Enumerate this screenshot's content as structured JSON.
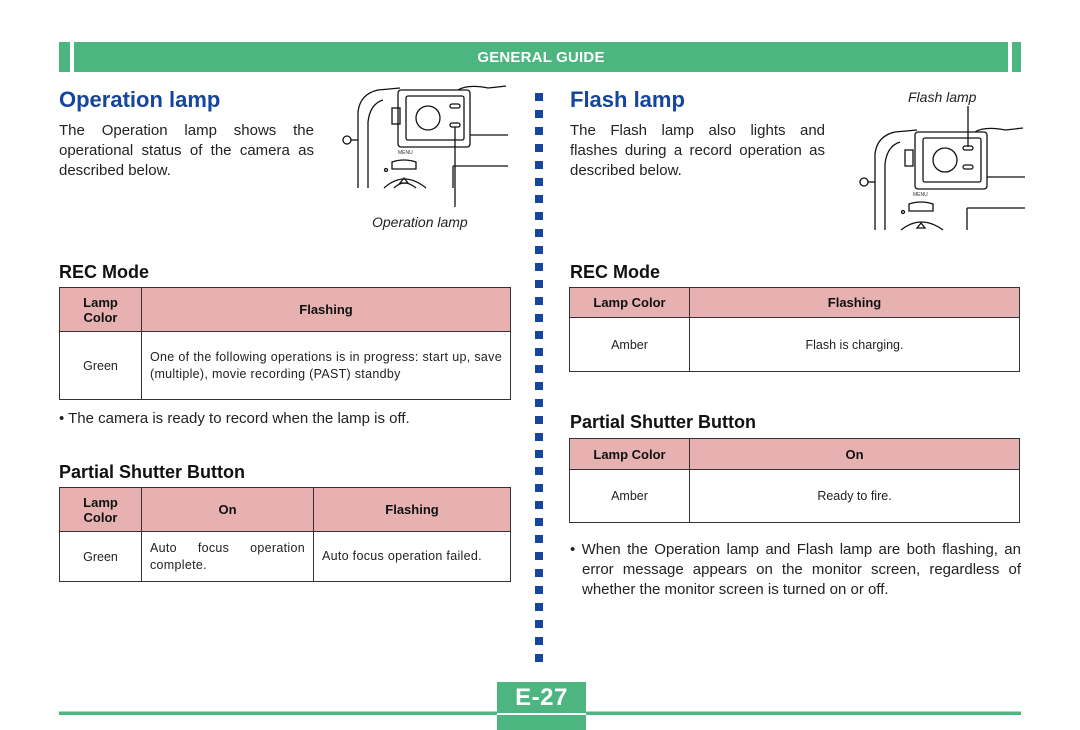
{
  "header": {
    "title": "GENERAL GUIDE"
  },
  "left": {
    "title": "Operation lamp",
    "intro": "The Operation lamp shows the operational status of the camera as described below.",
    "figure_caption": "Operation lamp",
    "figure_menu_label": "MENU",
    "rec_mode": {
      "heading": "REC Mode",
      "columns": [
        "Lamp Color",
        "Flashing"
      ],
      "rows": [
        [
          "Green",
          "One of the following operations is in progress: start up, save (multiple), movie recording (PAST) standby"
        ]
      ]
    },
    "rec_note": "• The camera is ready to record when the lamp is off.",
    "partial_shutter": {
      "heading": "Partial Shutter Button",
      "columns": [
        "Lamp Color",
        "On",
        "Flashing"
      ],
      "rows": [
        [
          "Green",
          "Auto focus operation complete.",
          "Auto focus operation failed."
        ]
      ]
    }
  },
  "right": {
    "title": "Flash lamp",
    "intro": "The Flash lamp also lights and flashes during a record operation as described below.",
    "figure_caption": "Flash lamp",
    "figure_menu_label": "MENU",
    "rec_mode": {
      "heading": "REC Mode",
      "columns": [
        "Lamp Color",
        "Flashing"
      ],
      "rows": [
        [
          "Amber",
          "Flash is charging."
        ]
      ]
    },
    "partial_shutter": {
      "heading": "Partial Shutter Button",
      "columns": [
        "Lamp Color",
        "On"
      ],
      "rows": [
        [
          "Amber",
          "Ready to fire."
        ]
      ]
    },
    "note": "• When the Operation lamp and Flash lamp are both flashing, an error message appears on the monitor screen, regardless of whether the monitor screen is turned on or off."
  },
  "footer": {
    "page_number": "E-27"
  },
  "colors": {
    "accent_green": "#4db680",
    "heading_blue": "#1645a0",
    "table_header_pink": "#e8b1b1"
  }
}
